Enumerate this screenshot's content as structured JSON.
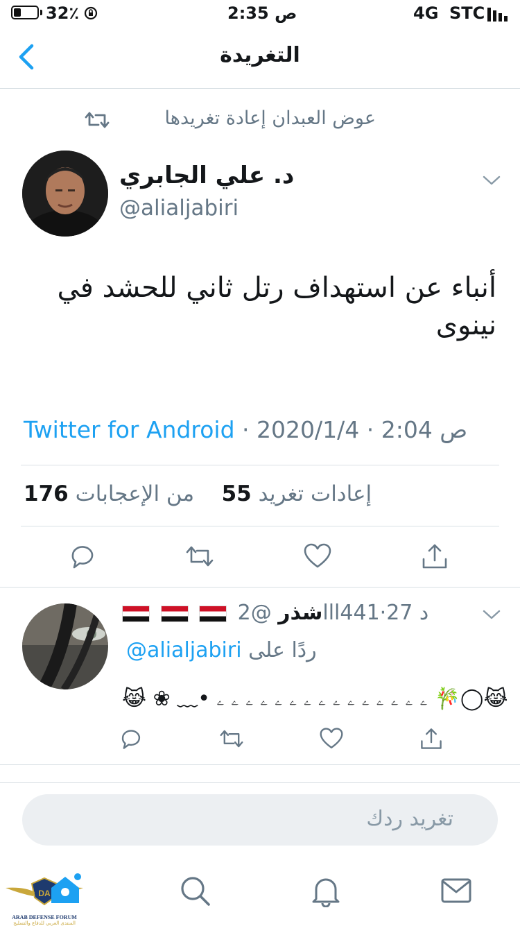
{
  "status_bar": {
    "battery": "32٪",
    "time": "2:35 ص",
    "network": "4G",
    "carrier": "STC"
  },
  "nav": {
    "title": "التغريدة"
  },
  "tweet": {
    "retweet_context": "عوض العبدان إعادة تغريدها",
    "author_name": "د. علي الجابري",
    "author_handle": "@alialjabiri",
    "text": "أنباء عن استهداف رتل ثاني للحشد في نينوى",
    "source": "Twitter for Android",
    "timestamp": " · 2020/1/4 · ص 2:04",
    "likes_count": "176",
    "likes_label": "من الإعجابات",
    "retweets_count": "55",
    "retweets_label": "إعادات تغريد"
  },
  "reply": {
    "time": "27 د",
    "handle": "@2lll441",
    "name": "شذر",
    "replying_label": "ردًا على",
    "replying_to": "@alialjabiri",
    "text": "😹 ❀ ﹏• ۦ ۦ ۦ ۦ ۦ ۦ ۦ ۦ ۦ ۦ ۦ ۦ ۦ ۦ ۦ 🎋◯😹"
  },
  "composer": {
    "placeholder": "تغريد ردك"
  },
  "watermark": {
    "line1": "ARAB DEFENSE FORUM",
    "line2": "المنتدى العربي للدفاع والتسليح"
  },
  "colors": {
    "accent": "#1da1f2",
    "secondary_text": "#657786",
    "divider": "#d8dfe4",
    "iraq_red": "#ce1126",
    "iraq_green": "#007a3d"
  },
  "icons": [
    "back-chevron-icon",
    "retweet-icon",
    "chevron-down-icon",
    "reply-icon",
    "like-icon",
    "share-icon",
    "home-icon",
    "search-icon",
    "notifications-icon",
    "messages-icon"
  ]
}
